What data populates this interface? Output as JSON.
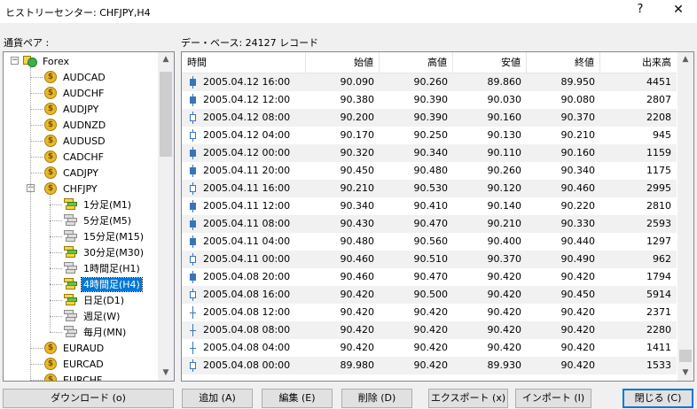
{
  "window": {
    "title": "ヒストリーセンター: CHFJPY,H4",
    "help": "?",
    "close": "✕"
  },
  "left_label": "通貨ペア :",
  "db_label": "デー・ベース: 24127 レコード",
  "tree": {
    "root": "Forex",
    "pairs_before": [
      "AUDCAD",
      "AUDCHF",
      "AUDJPY",
      "AUDNZD",
      "AUDUSD",
      "CADCHF",
      "CADJPY"
    ],
    "expanded_pair": "CHFJPY",
    "timeframes": [
      {
        "label": "1分足(M1)",
        "active": true
      },
      {
        "label": "5分足(M5)",
        "active": false
      },
      {
        "label": "15分足(M15)",
        "active": false
      },
      {
        "label": "30分足(M30)",
        "active": true
      },
      {
        "label": "1時間足(H1)",
        "active": false
      },
      {
        "label": "4時間足(H4)",
        "active": true,
        "selected": true
      },
      {
        "label": "日足(D1)",
        "active": true
      },
      {
        "label": "週足(W)",
        "active": false
      },
      {
        "label": "毎月(MN)",
        "active": false
      }
    ],
    "pairs_after": [
      "EURAUD",
      "EURCAD",
      "EURCHF"
    ]
  },
  "table": {
    "columns": [
      "時間",
      "始値",
      "高値",
      "安値",
      "終値",
      "出来高"
    ],
    "rows": [
      {
        "time": "2005.04.12 16:00",
        "open": "90.090",
        "high": "90.260",
        "low": "89.860",
        "close": "89.950",
        "volume": "4451",
        "candle": "bear"
      },
      {
        "time": "2005.04.12 12:00",
        "open": "90.380",
        "high": "90.390",
        "low": "90.030",
        "close": "90.080",
        "volume": "2807",
        "candle": "bear"
      },
      {
        "time": "2005.04.12 08:00",
        "open": "90.200",
        "high": "90.390",
        "low": "90.160",
        "close": "90.370",
        "volume": "2208",
        "candle": "bull"
      },
      {
        "time": "2005.04.12 04:00",
        "open": "90.170",
        "high": "90.250",
        "low": "90.130",
        "close": "90.210",
        "volume": "945",
        "candle": "bull"
      },
      {
        "time": "2005.04.12 00:00",
        "open": "90.320",
        "high": "90.340",
        "low": "90.110",
        "close": "90.160",
        "volume": "1159",
        "candle": "bear"
      },
      {
        "time": "2005.04.11 20:00",
        "open": "90.450",
        "high": "90.480",
        "low": "90.260",
        "close": "90.340",
        "volume": "1175",
        "candle": "bear"
      },
      {
        "time": "2005.04.11 16:00",
        "open": "90.210",
        "high": "90.530",
        "low": "90.120",
        "close": "90.460",
        "volume": "2995",
        "candle": "bull"
      },
      {
        "time": "2005.04.11 12:00",
        "open": "90.340",
        "high": "90.410",
        "low": "90.140",
        "close": "90.220",
        "volume": "2810",
        "candle": "bear"
      },
      {
        "time": "2005.04.11 08:00",
        "open": "90.430",
        "high": "90.470",
        "low": "90.210",
        "close": "90.330",
        "volume": "2593",
        "candle": "bear"
      },
      {
        "time": "2005.04.11 04:00",
        "open": "90.480",
        "high": "90.560",
        "low": "90.400",
        "close": "90.440",
        "volume": "1297",
        "candle": "bear"
      },
      {
        "time": "2005.04.11 00:00",
        "open": "90.460",
        "high": "90.510",
        "low": "90.370",
        "close": "90.490",
        "volume": "962",
        "candle": "bull"
      },
      {
        "time": "2005.04.08 20:00",
        "open": "90.460",
        "high": "90.470",
        "low": "90.420",
        "close": "90.420",
        "volume": "1794",
        "candle": "bear"
      },
      {
        "time": "2005.04.08 16:00",
        "open": "90.420",
        "high": "90.500",
        "low": "90.420",
        "close": "90.450",
        "volume": "5914",
        "candle": "bull"
      },
      {
        "time": "2005.04.08 12:00",
        "open": "90.420",
        "high": "90.420",
        "low": "90.420",
        "close": "90.420",
        "volume": "2371",
        "candle": "doji"
      },
      {
        "time": "2005.04.08 08:00",
        "open": "90.420",
        "high": "90.420",
        "low": "90.420",
        "close": "90.420",
        "volume": "2280",
        "candle": "doji"
      },
      {
        "time": "2005.04.08 04:00",
        "open": "90.420",
        "high": "90.420",
        "low": "90.420",
        "close": "90.420",
        "volume": "1411",
        "candle": "doji"
      },
      {
        "time": "2005.04.08 00:00",
        "open": "89.980",
        "high": "90.420",
        "low": "89.930",
        "close": "90.420",
        "volume": "1533",
        "candle": "bull"
      }
    ]
  },
  "buttons": {
    "download": "ダウンロード (o)",
    "add": "追加 (A)",
    "edit": "編集 (E)",
    "delete": "削除 (D)",
    "export": "エクスポート (x)",
    "import": "インポート (I)",
    "close": "閉じる (C)"
  },
  "colors": {
    "selection": "#0078d7",
    "candle": "#3a74b8",
    "coin": "#e9b92c"
  },
  "icons": {
    "expander_open": "−",
    "coin_symbol": "$",
    "scroll_up": "▲",
    "scroll_down": "▼"
  }
}
